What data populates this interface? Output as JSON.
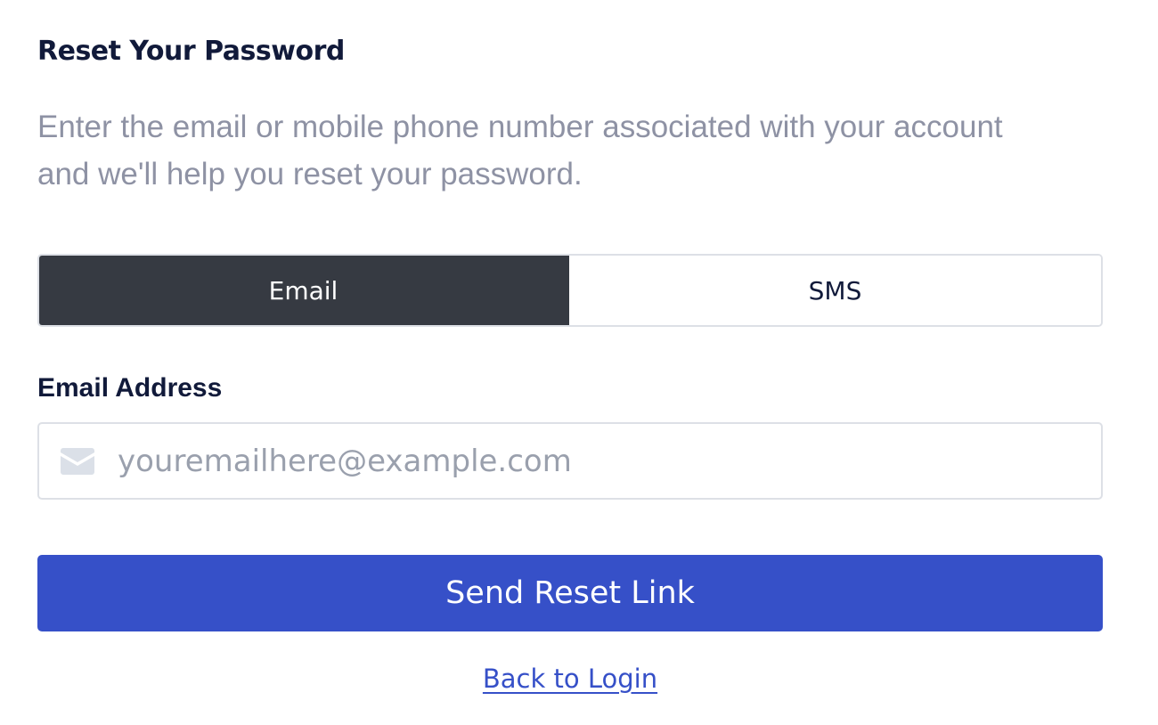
{
  "page": {
    "title": "Reset Your Password",
    "subtitle": "Enter the email or mobile phone number associated with your account and we'll help you reset your password."
  },
  "method_toggle": {
    "options": [
      {
        "label": "Email",
        "active": true
      },
      {
        "label": "SMS",
        "active": false
      }
    ]
  },
  "email_field": {
    "label": "Email Address",
    "value": "",
    "placeholder": "youremailhere@example.com",
    "icon": "envelope-icon"
  },
  "actions": {
    "submit_label": "Send Reset Link",
    "back_link_label": "Back to Login"
  },
  "colors": {
    "title": "#111a3a",
    "subtitle": "#8e92a4",
    "toggle_active_bg": "#363a42",
    "primary": "#3650c8",
    "border": "#dde0e6",
    "icon": "#dbe0e8"
  }
}
